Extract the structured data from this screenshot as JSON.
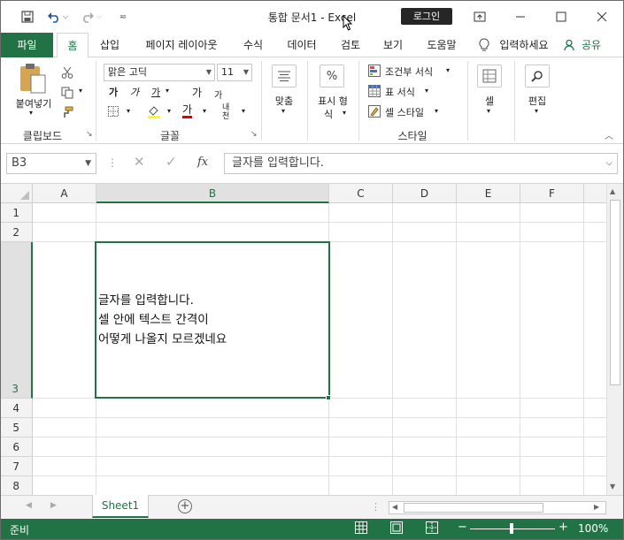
{
  "titlebar": {
    "title": "통합 문서1  -  Excel",
    "login_label": "로그인",
    "icons": [
      "save-icon",
      "undo-icon",
      "redo-icon",
      "customize-icon",
      "ribbon-display-icon",
      "minimize-icon",
      "maximize-icon",
      "close-icon"
    ]
  },
  "tabs": {
    "file": "파일",
    "home": "홈",
    "insert": "삽입",
    "layout": "페이지 레이아웃",
    "formulas": "수식",
    "data": "데이터",
    "review": "검토",
    "view": "보기",
    "help": "도움말",
    "tell_me": "입력하세요",
    "share": "공유"
  },
  "ribbon": {
    "clipboard": {
      "paste": "붙여넣기",
      "label": "클립보드"
    },
    "font": {
      "name": "맑은 고딕",
      "size": "11",
      "bold": "가",
      "italic": "가",
      "underline": "가",
      "grow": "가",
      "shrink": "가",
      "font_color": "가",
      "phonetic": "내천",
      "label": "글꼴"
    },
    "alignment": {
      "label": "맞춤"
    },
    "number": {
      "label_line1": "표시 형",
      "label_line2": "식"
    },
    "styles": {
      "conditional": "조건부 서식",
      "table": "표 서식",
      "cell_styles": "셀 스타일",
      "label": "스타일"
    },
    "cells": {
      "label": "셀"
    },
    "editing": {
      "label": "편집"
    }
  },
  "formula_bar": {
    "name_box": "B3",
    "fx": "fx",
    "content": "글자를 입력합니다."
  },
  "grid": {
    "columns": [
      "A",
      "B",
      "C",
      "D",
      "E",
      "F"
    ],
    "rows": [
      "1",
      "2",
      "3",
      "4",
      "5",
      "6",
      "7",
      "8"
    ],
    "cell_b3_text": "글자를 입력합니다.\n셀 안에 텍스트 간격이\n어떻게 나올지 모르겠네요"
  },
  "sheets": {
    "active": "Sheet1"
  },
  "status": {
    "mode": "준비",
    "zoom": "100%"
  },
  "colors": {
    "accent": "#217346"
  }
}
